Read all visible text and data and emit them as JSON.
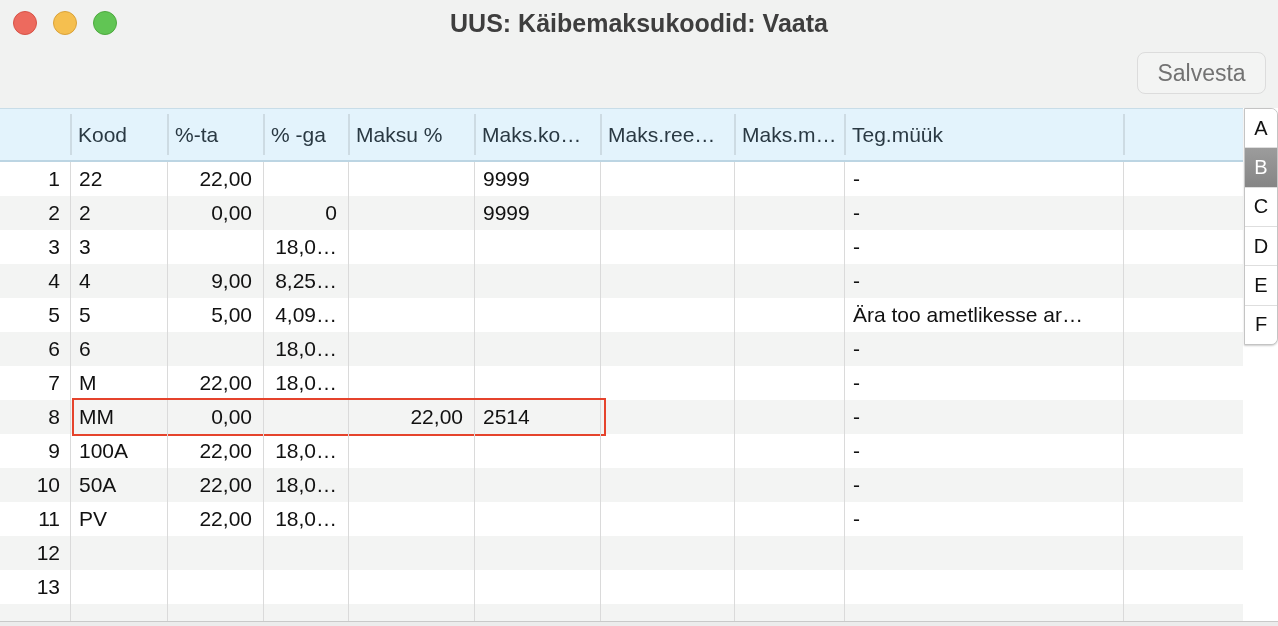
{
  "window": {
    "title": "UUS: Käibemaksukoodid: Vaata"
  },
  "toolbar": {
    "buttons": [
      {
        "label": "Salvesta",
        "disabled": true
      }
    ]
  },
  "table": {
    "columns": [
      {
        "label": "Kood",
        "kind": "text"
      },
      {
        "label": "%-ta",
        "kind": "number"
      },
      {
        "label": "% -ga",
        "kind": "number"
      },
      {
        "label": "Maksu %",
        "kind": "number"
      },
      {
        "label": "Maks.ko…",
        "kind": "text"
      },
      {
        "label": "Maks.ree…",
        "kind": "text"
      },
      {
        "label": "Maks.m…",
        "kind": "text"
      },
      {
        "label": "Teg.müük",
        "kind": "text"
      }
    ],
    "rows": [
      {
        "number": "1",
        "outlined": false,
        "cells": [
          "22",
          "22,00",
          null,
          null,
          "9999",
          null,
          null,
          "-"
        ]
      },
      {
        "number": "2",
        "outlined": false,
        "cells": [
          "2",
          "0,00",
          "0",
          null,
          "9999",
          null,
          null,
          "-"
        ]
      },
      {
        "number": "3",
        "outlined": false,
        "cells": [
          "3",
          null,
          "18,0…",
          null,
          null,
          null,
          null,
          "-"
        ]
      },
      {
        "number": "4",
        "outlined": false,
        "cells": [
          "4",
          "9,00",
          "8,25…",
          null,
          null,
          null,
          null,
          "-"
        ]
      },
      {
        "number": "5",
        "outlined": false,
        "cells": [
          "5",
          "5,00",
          "4,09…",
          null,
          null,
          null,
          null,
          "Ära too ametlikesse ar…"
        ]
      },
      {
        "number": "6",
        "outlined": false,
        "cells": [
          "6",
          null,
          "18,0…",
          null,
          null,
          null,
          null,
          "-"
        ]
      },
      {
        "number": "7",
        "outlined": false,
        "cells": [
          "M",
          "22,00",
          "18,0…",
          null,
          null,
          null,
          null,
          "-"
        ]
      },
      {
        "number": "8",
        "outlined": true,
        "cells": [
          "MM",
          "0,00",
          null,
          "22,00",
          "2514",
          null,
          null,
          "-"
        ]
      },
      {
        "number": "9",
        "outlined": false,
        "cells": [
          "100A",
          "22,00",
          "18,0…",
          null,
          null,
          null,
          null,
          "-"
        ]
      },
      {
        "number": "10",
        "outlined": false,
        "cells": [
          "50A",
          "22,00",
          "18,0…",
          null,
          null,
          null,
          null,
          "-"
        ]
      },
      {
        "number": "11",
        "outlined": false,
        "cells": [
          "PV",
          "22,00",
          "18,0…",
          null,
          null,
          null,
          null,
          "-"
        ]
      },
      {
        "number": "12",
        "outlined": false,
        "cells": [
          null,
          null,
          null,
          null,
          null,
          null,
          null,
          null
        ]
      },
      {
        "number": "13",
        "outlined": false,
        "cells": [
          null,
          null,
          null,
          null,
          null,
          null,
          null,
          null
        ]
      }
    ]
  },
  "index_bar": [
    {
      "letter": "A",
      "selected": false
    },
    {
      "letter": "B",
      "selected": true
    },
    {
      "letter": "C",
      "selected": false
    },
    {
      "letter": "D",
      "selected": false
    },
    {
      "letter": "E",
      "selected": false
    },
    {
      "letter": "F",
      "selected": false
    }
  ]
}
